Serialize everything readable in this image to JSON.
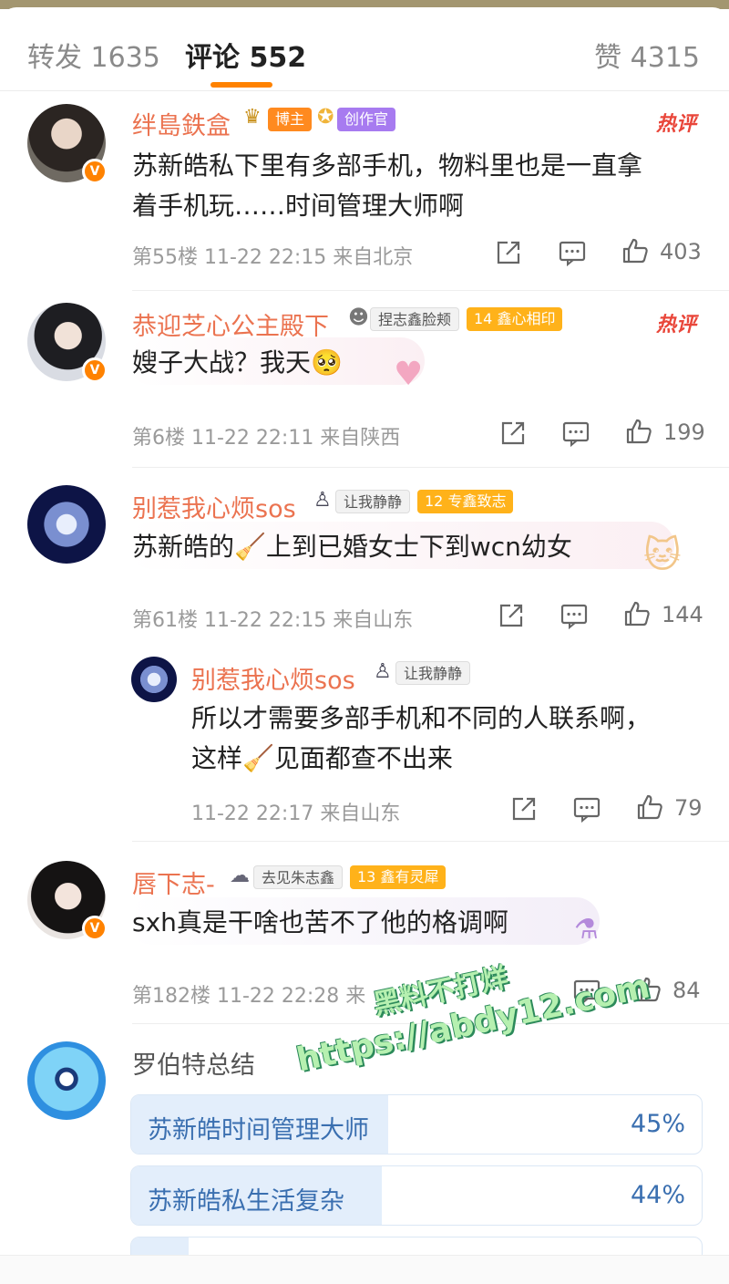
{
  "tabs": {
    "repost_label": "转发 1635",
    "comment_label": "评论 552",
    "like_label": "赞 4315"
  },
  "colors": {
    "accent": "#ff8200",
    "username": "#eb7350",
    "hot": "#e9463a",
    "poll": "#3a6fb0"
  },
  "comments": [
    {
      "username": "绊島鉄盒",
      "badges": [
        "博主",
        "创作官"
      ],
      "hot": "热评",
      "text": [
        "苏新皓私下里有多部手机，物料里也是一直拿",
        "着手机玩……时间管理大师啊"
      ],
      "meta": "第55楼 11-22 22:15 来自北京",
      "likes": "403"
    },
    {
      "username": "恭迎芝心公主殿下",
      "badges": [
        "捏志鑫脸颊",
        "鑫心相印"
      ],
      "fan_level": "14",
      "hot": "热评",
      "text": [
        "嫂子大战？我天🥺"
      ],
      "meta": "第6楼 11-22 22:11 来自陕西",
      "likes": "199"
    },
    {
      "username": "别惹我心烦sos",
      "badges": [
        "让我静静",
        "专鑫致志"
      ],
      "fan_level": "12",
      "text": [
        "苏新皓的🧹上到已婚女士下到wcn幼女"
      ],
      "meta": "第61楼 11-22 22:15 来自山东",
      "likes": "144"
    },
    {
      "username": "唇下志-",
      "badges": [
        "去见朱志鑫",
        "鑫有灵犀"
      ],
      "fan_level": "13",
      "text": [
        "sxh真是干啥也苦不了他的格调啊"
      ],
      "meta": "第182楼 11-22 22:28 来",
      "likes": "84"
    }
  ],
  "reply": {
    "username": "别惹我心烦sos",
    "badge": "让我静静",
    "text": [
      "所以才需要多部手机和不同的人联系啊，",
      "这样🧹见面都查不出来"
    ],
    "meta": "11-22 22:17 来自山东",
    "likes": "79"
  },
  "poll": {
    "author": "罗伯特总结",
    "options": [
      {
        "label": "苏新皓时间管理大师",
        "percent": "45%",
        "fraction": 0.45
      },
      {
        "label": "苏新皓私生活复杂",
        "percent": "44%",
        "fraction": 0.44
      },
      {
        "label": "",
        "percent": "",
        "fraction": 0.1
      }
    ]
  },
  "watermark": {
    "line1": "黑料不打烊",
    "line2": "https://abdy12.com"
  },
  "icons": [
    "repost-icon",
    "reply-icon",
    "like-icon",
    "v-badge-icon",
    "crown-icon",
    "medal-icon"
  ]
}
